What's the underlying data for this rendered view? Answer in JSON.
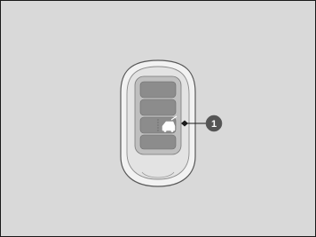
{
  "figure": {
    "background_color": "#d9d9d9",
    "fob_body_color": "#f2f2f2",
    "fob_inner_color": "#bfbfbf",
    "button_color": "#8c8c8c",
    "callout_color": "#555555",
    "icon": "tailgate-icon"
  },
  "callouts": [
    {
      "number": "1"
    }
  ]
}
